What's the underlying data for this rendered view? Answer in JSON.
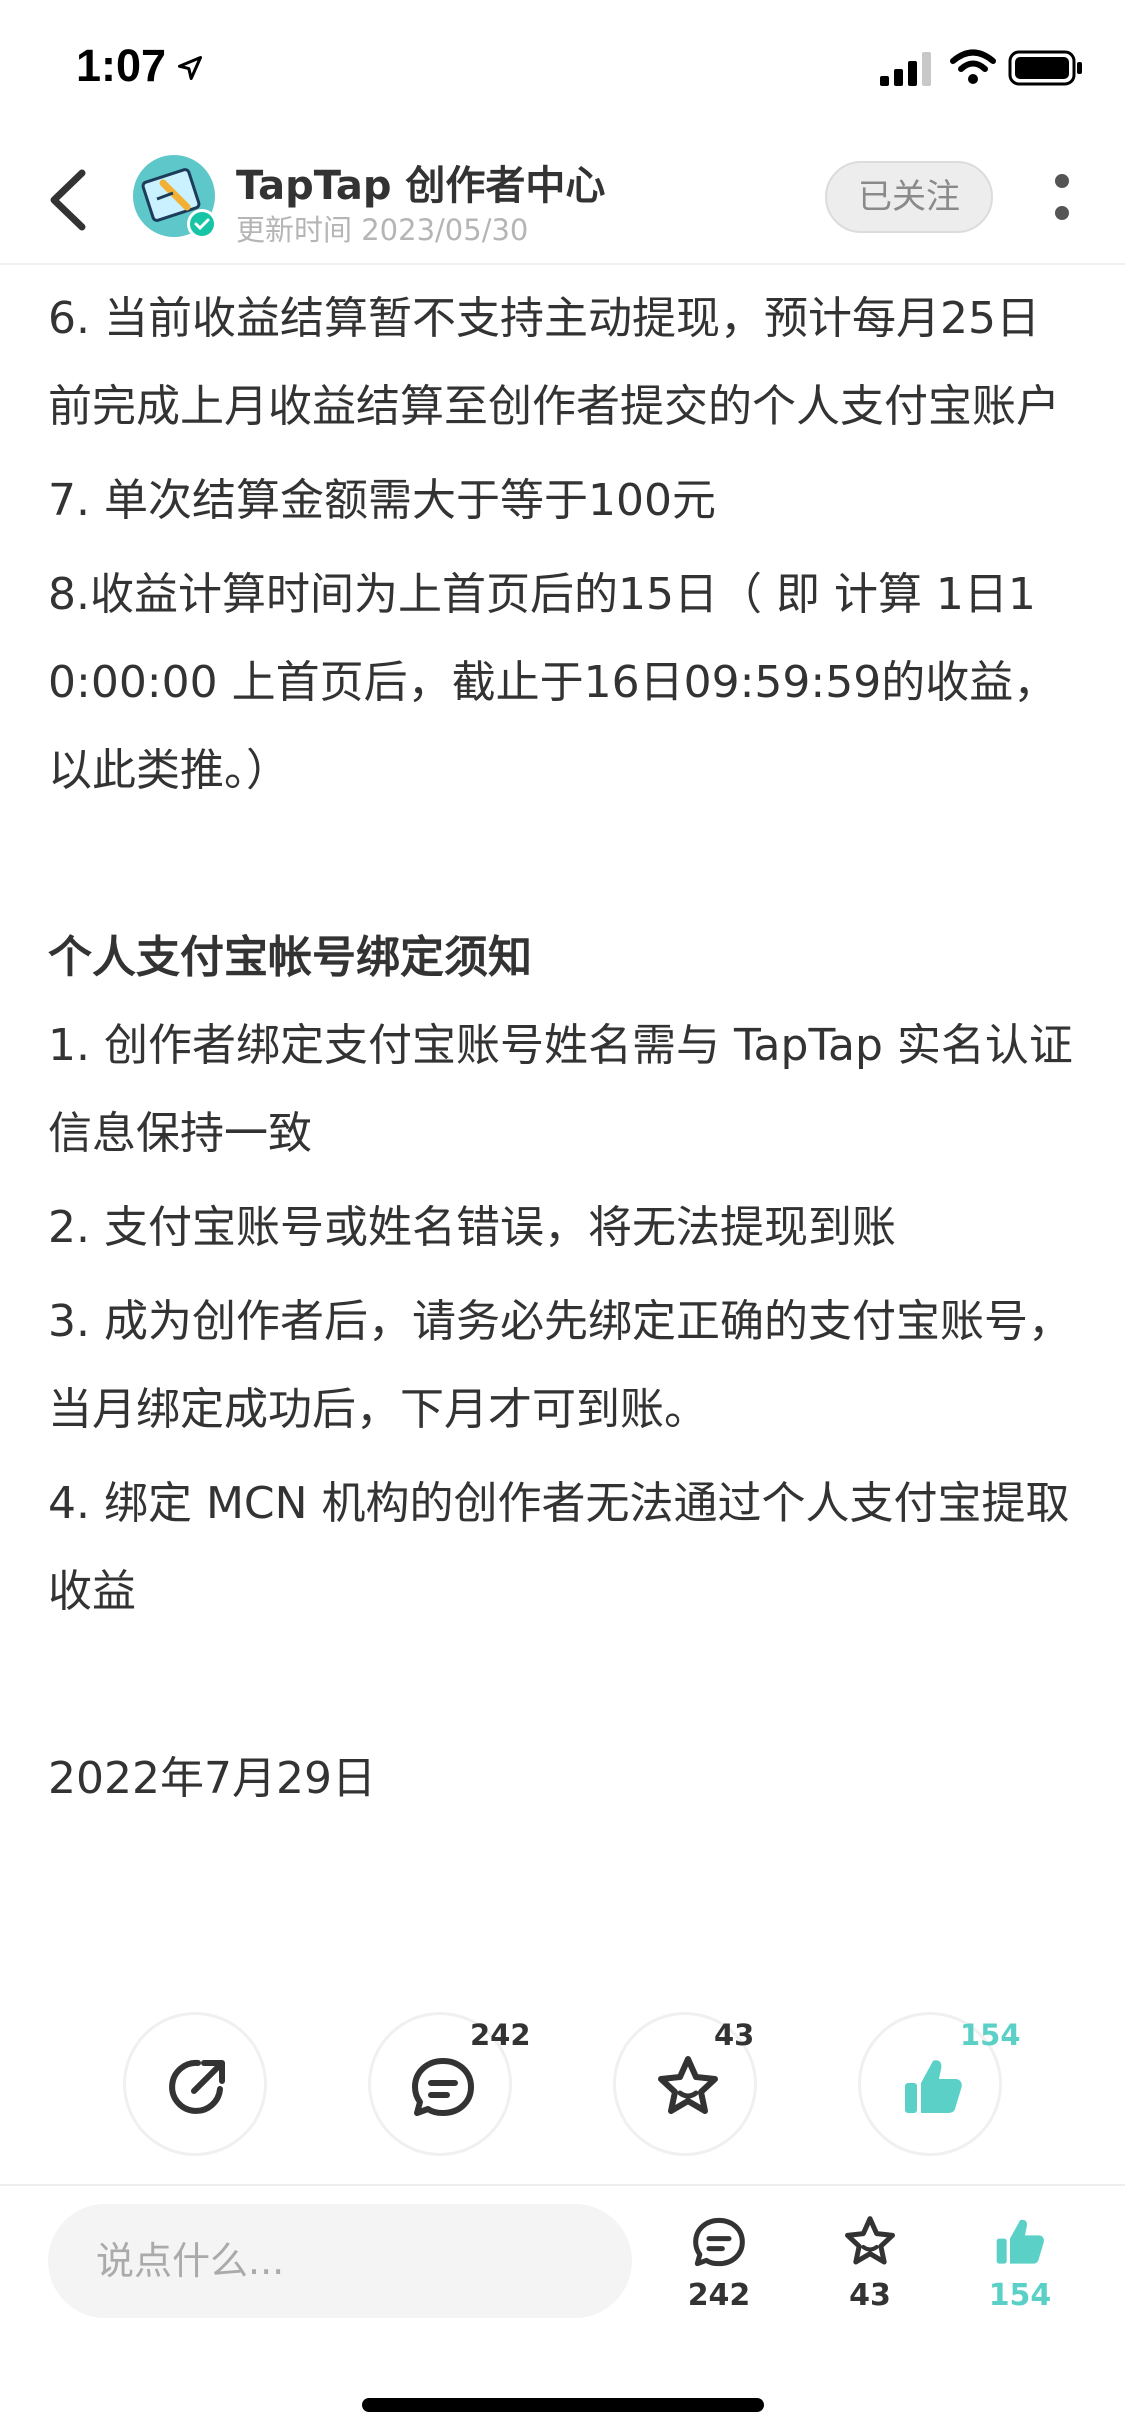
{
  "status_bar": {
    "time": "1:07"
  },
  "header": {
    "channel_name": "TapTap 创作者中心",
    "update_time": "更新时间 2023/05/30",
    "follow_label": "已关注"
  },
  "article": {
    "items_top": [
      "6. 当前收益结算暂不支持主动提现，预计每月25日前完成上月收益结算至创作者提交的个人支付宝账户",
      "7. 单次结算金额需大于等于100元",
      "8.收益计算时间为上首页后的15日（ 即 计算 1日10:00:00 上首页后，截止于16日09:59:59的收益，以此类推。）"
    ],
    "section_title": "个人支付宝帐号绑定须知",
    "items_section": [
      "1. 创作者绑定支付宝账号姓名需与 TapTap 实名认证信息保持一致",
      "2. 支付宝账号或姓名错误，将无法提现到账",
      "3. 成为创作者后，请务必先绑定正确的支付宝账号，当月绑定成功后，下月才可到账。",
      "4. 绑定 MCN 机构的创作者无法通过个人支付宝提取收益"
    ],
    "date": "2022年7月29日"
  },
  "actions": {
    "comment_count": "242",
    "favorite_count": "43",
    "like_count": "154"
  },
  "bottom_bar": {
    "input_placeholder": "说点什么...",
    "comment_count": "242",
    "favorite_count": "43",
    "like_count": "154"
  },
  "colors": {
    "accent": "#5bd0c6",
    "follow_bg": "#ededed",
    "text": "#333333"
  },
  "icons": [
    "back-arrow-icon",
    "share-icon",
    "comment-icon",
    "star-icon",
    "thumbs-up-icon",
    "more-dots-icon",
    "location-arrow-icon",
    "signal-icon",
    "wifi-icon",
    "battery-icon"
  ]
}
